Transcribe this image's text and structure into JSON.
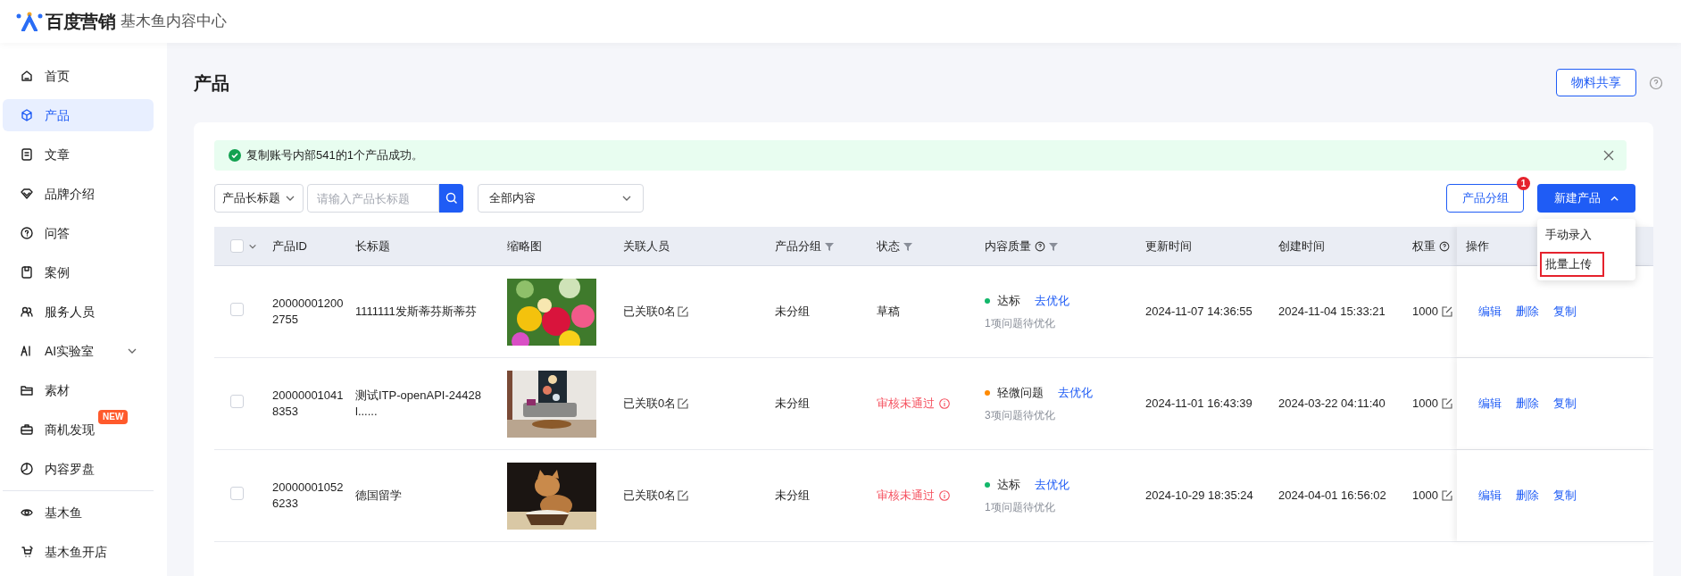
{
  "header": {
    "brand": "百度营销",
    "product": "基木鱼内容中心"
  },
  "sidebar": {
    "groups": [
      [
        {
          "label": "首页",
          "selected": false
        },
        {
          "label": "产品",
          "selected": true
        },
        {
          "label": "文章",
          "selected": false
        },
        {
          "label": "品牌介绍",
          "selected": false
        },
        {
          "label": "问答",
          "selected": false
        },
        {
          "label": "案例",
          "selected": false
        },
        {
          "label": "服务人员",
          "selected": false
        },
        {
          "label": "AI实验室",
          "selected": false,
          "expanded": false
        },
        {
          "label": "素材",
          "selected": false
        },
        {
          "label": "商机发现",
          "selected": false,
          "badge": "NEW"
        },
        {
          "label": "内容罗盘",
          "selected": false
        }
      ],
      [
        {
          "label": "基木鱼",
          "selected": false
        },
        {
          "label": "基木鱼开店",
          "selected": false
        }
      ]
    ]
  },
  "page": {
    "title": "产品",
    "share_button": "物料共享"
  },
  "alert": {
    "text": "复制账号内部541的1个产品成功。"
  },
  "filters": {
    "field_select": "产品长标题",
    "search": {
      "placeholder": "请输入产品长标题"
    },
    "content_select": "全部内容"
  },
  "actions": {
    "group_button": "产品分组",
    "group_badge": "1",
    "new_button": "新建产品",
    "menu": [
      {
        "label": "手动录入",
        "selected": false
      },
      {
        "label": "批量上传",
        "selected": true
      }
    ]
  },
  "table": {
    "select_all_checked": false,
    "columns": [
      {
        "label": "产品ID"
      },
      {
        "label": "长标题"
      },
      {
        "label": "缩略图"
      },
      {
        "label": "关联人员"
      },
      {
        "label": "产品分组",
        "filter": true
      },
      {
        "label": "状态",
        "filter": true
      },
      {
        "label": "内容质量",
        "help": true,
        "filter": true
      },
      {
        "label": "更新时间"
      },
      {
        "label": "创建时间"
      },
      {
        "label": "权重",
        "help": true
      },
      {
        "label": "操作"
      }
    ],
    "rows": [
      {
        "checked": false,
        "id": "200000012002755",
        "title": "1111111发斯蒂芬斯蒂芬",
        "people": "已关联0名",
        "group": "未分组",
        "status": {
          "text": "草稿",
          "kind": "draft"
        },
        "quality": {
          "label": "达标",
          "color": "#12b76a",
          "link": "去优化",
          "note": "1项问题待优化"
        },
        "updated": "2024-11-07 14:36:55",
        "created": "2024-11-04 15:33:21",
        "weight": "1000",
        "actions": [
          "编辑",
          "删除",
          "复制"
        ]
      },
      {
        "checked": false,
        "id": "200000010418353",
        "title": "测试ITP-openAPI-24428l......",
        "people": "已关联0名",
        "group": "未分组",
        "status": {
          "text": "审核未通过",
          "kind": "rejected"
        },
        "quality": {
          "label": "轻微问题",
          "color": "#ff8a00",
          "link": "去优化",
          "note": "3项问题待优化"
        },
        "updated": "2024-11-01 16:43:39",
        "created": "2024-03-22 04:11:40",
        "weight": "1000",
        "actions": [
          "编辑",
          "删除",
          "复制"
        ]
      },
      {
        "checked": false,
        "id": "200000010526233",
        "title": "德国留学",
        "people": "已关联0名",
        "group": "未分组",
        "status": {
          "text": "审核未通过",
          "kind": "rejected"
        },
        "quality": {
          "label": "达标",
          "color": "#12b76a",
          "link": "去优化",
          "note": "1项问题待优化"
        },
        "updated": "2024-10-29 18:35:24",
        "created": "2024-04-01 16:56:02",
        "weight": "1000",
        "actions": [
          "编辑",
          "删除",
          "复制"
        ]
      }
    ]
  }
}
